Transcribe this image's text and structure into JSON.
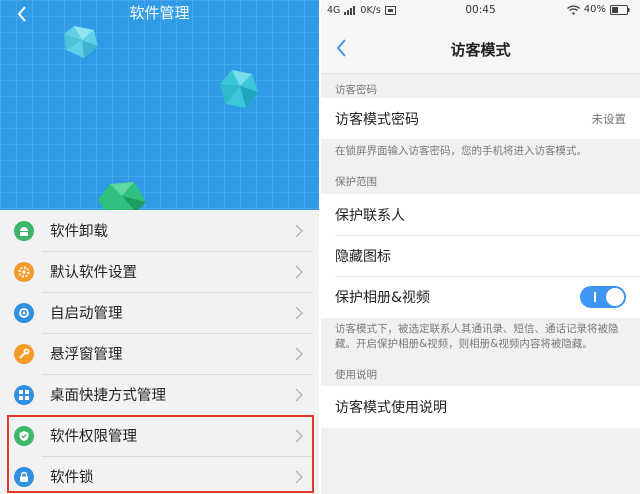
{
  "left": {
    "title": "软件管理",
    "items": [
      {
        "label": "软件卸载",
        "icon": "android-icon",
        "color": "#3db56a"
      },
      {
        "label": "默认软件设置",
        "icon": "gear-icon",
        "color": "#f39a27"
      },
      {
        "label": "自启动管理",
        "icon": "power-cycle-icon",
        "color": "#2f8fe0"
      },
      {
        "label": "悬浮窗管理",
        "icon": "wrench-icon",
        "color": "#f39a27"
      },
      {
        "label": "桌面快捷方式管理",
        "icon": "grid-icon",
        "color": "#2f8fe0"
      },
      {
        "label": "软件权限管理",
        "icon": "shield-check-icon",
        "color": "#3db56a"
      },
      {
        "label": "软件锁",
        "icon": "lock-icon",
        "color": "#2f8fe0"
      }
    ],
    "hero_color": "#2f9be6",
    "highlight_color": "#e23b2b"
  },
  "right": {
    "status": {
      "signal": "4G",
      "speed": "0K/s",
      "time": "00:45",
      "battery": "40%"
    },
    "title": "访客模式",
    "sections": {
      "password_header": "访客密码",
      "password_label": "访客模式密码",
      "password_value": "未设置",
      "password_note": "在锁屏界面输入访客密码，您的手机将进入访客模式。",
      "scope_header": "保护范围",
      "protect_contacts": "保护联系人",
      "hide_icons": "隐藏图标",
      "protect_album": "保护相册&视频",
      "scope_note": "访客模式下，被选定联系人其通讯录、短信、通话记录将被隐藏。开启保护相册&视频，则相册&视频内容将被隐藏。",
      "help_header": "使用说明",
      "help_label": "访客模式使用说明"
    },
    "toggle_on": true,
    "accent": "#3d96f2"
  }
}
